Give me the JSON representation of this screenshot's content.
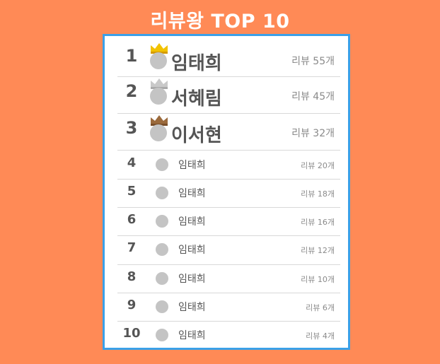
{
  "title": "리뷰왕 TOP 10",
  "rows": [
    {
      "rank": "1",
      "name": "임태희",
      "count": "리뷰 55개",
      "crown": "gold-crown-icon"
    },
    {
      "rank": "2",
      "name": "서혜림",
      "count": "리뷰 45개",
      "crown": "silver-crown-icon"
    },
    {
      "rank": "3",
      "name": "이서현",
      "count": "리뷰 32개",
      "crown": "bronze-crown-icon"
    },
    {
      "rank": "4",
      "name": "임태희",
      "count": "리뷰 20개"
    },
    {
      "rank": "5",
      "name": "임태희",
      "count": "리뷰 18개"
    },
    {
      "rank": "6",
      "name": "임태희",
      "count": "리뷰 16개"
    },
    {
      "rank": "7",
      "name": "임태희",
      "count": "리뷰 12개"
    },
    {
      "rank": "8",
      "name": "임태희",
      "count": "리뷰 10개"
    },
    {
      "rank": "9",
      "name": "임태희",
      "count": "리뷰 6개"
    },
    {
      "rank": "10",
      "name": "임태희",
      "count": "리뷰 4개"
    }
  ],
  "colors": {
    "background": "#ff8a56",
    "panel_border": "#3aa0e8",
    "gold": "#f2c200",
    "silver": "#c9c9c9",
    "bronze": "#9b6a3c",
    "avatar": "#c4c4c4"
  }
}
